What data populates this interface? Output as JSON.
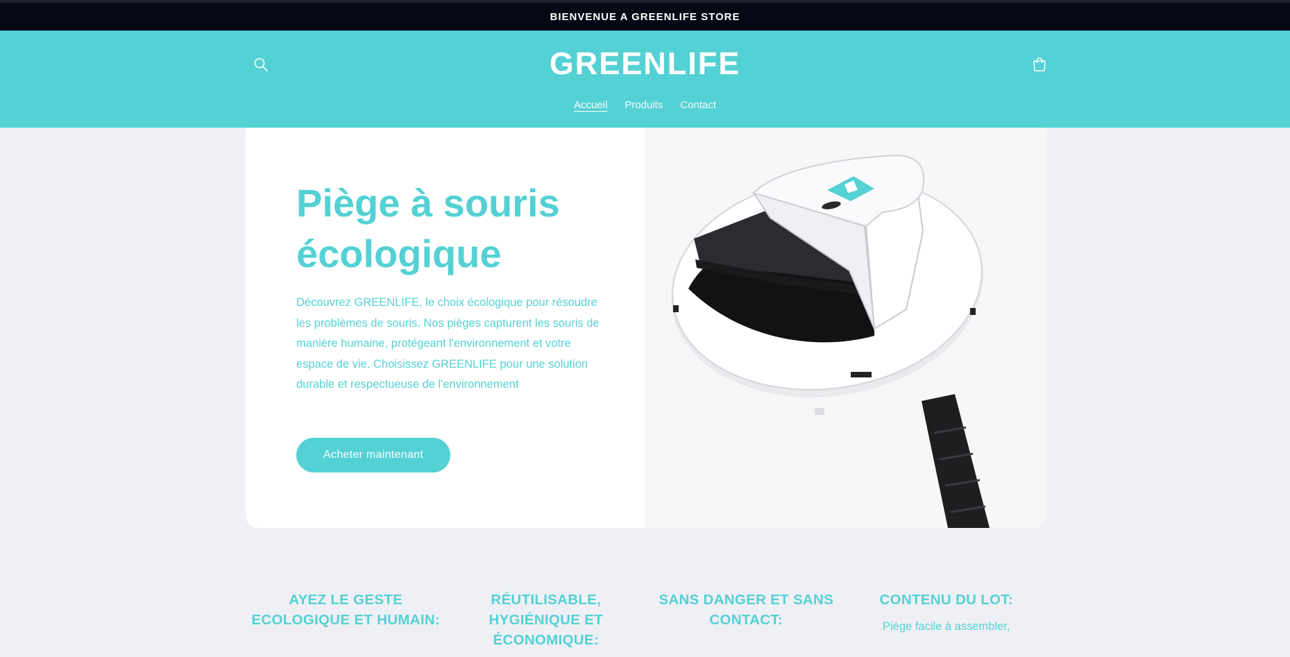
{
  "announcement": {
    "text": "BIENVENUE A GREENLIFE STORE"
  },
  "header": {
    "logo": "GREENLIFE",
    "search_icon": "search-icon",
    "cart_icon": "cart-icon",
    "nav": [
      {
        "label": "Accueil",
        "active": true
      },
      {
        "label": "Produits",
        "active": false
      },
      {
        "label": "Contact",
        "active": false
      }
    ]
  },
  "hero": {
    "title_line1": "Piège à souris",
    "title_line2": "écologique",
    "description": "Découvrez GREENLIFE, le choix écologique pour résoudre les problèmes de souris. Nos pièges capturent les souris de manière humaine, protégeant l'environnement et votre espace de vie. Choisissez GREENLIFE pour une solution durable et respectueuse de l'environnement",
    "cta_label": "Acheter maintenant",
    "image_label": "GREENLIFE"
  },
  "features": [
    {
      "title": "AYEZ LE GESTE ECOLOGIQUE ET HUMAIN:",
      "text": ""
    },
    {
      "title": "RÉUTILISABLE, HYGIÉNIQUE ET ÉCONOMIQUE:",
      "text": ""
    },
    {
      "title": "SANS DANGER ET SANS CONTACT:",
      "text": ""
    },
    {
      "title": "CONTENU DU LOT:",
      "text": "Piège facile à assembler,"
    }
  ],
  "colors": {
    "accent": "#54d1d4",
    "announcement_bg": "#050914",
    "page_bg": "#eff0f5"
  }
}
